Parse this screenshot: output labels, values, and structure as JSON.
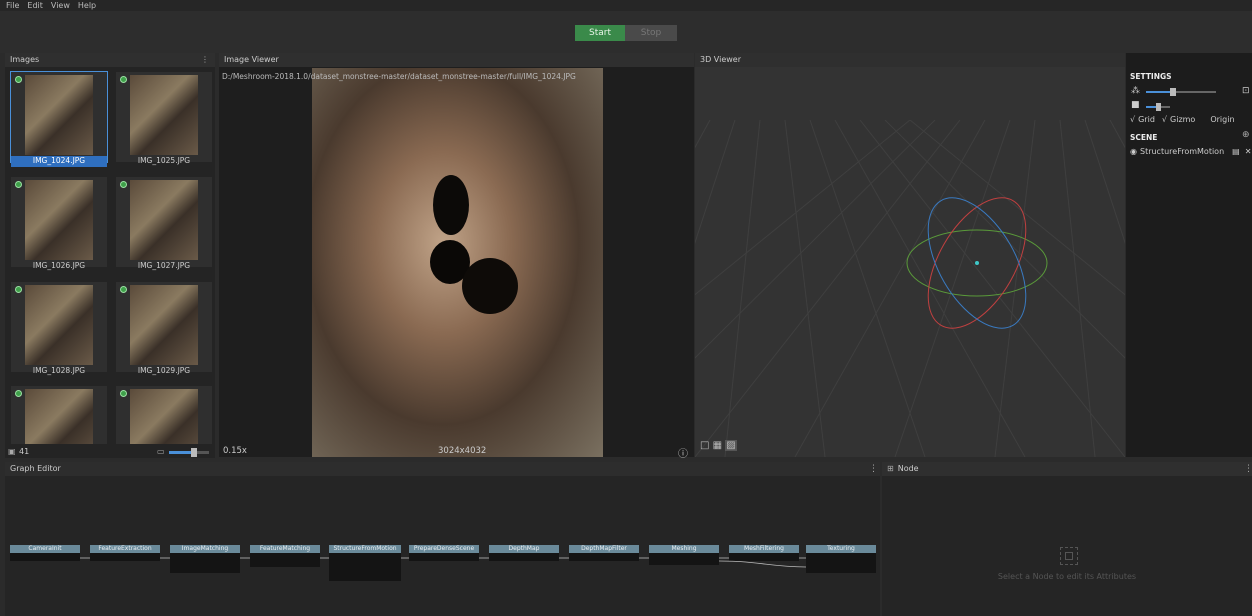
{
  "menu": [
    "File",
    "Edit",
    "View",
    "Help"
  ],
  "toolbar": {
    "start_label": "Start",
    "stop_label": "Stop"
  },
  "images": {
    "title": "Images",
    "count": "41",
    "thumbs": [
      "IMG_1024.JPG",
      "IMG_1025.JPG",
      "IMG_1026.JPG",
      "IMG_1027.JPG",
      "IMG_1028.JPG",
      "IMG_1029.JPG",
      "",
      ""
    ]
  },
  "viewer": {
    "title": "Image Viewer",
    "path": "D:/Meshroom-2018.1.0/dataset_monstree-master/dataset_monstree-master/full/IMG_1024.JPG",
    "zoom": "0.15x",
    "resolution": "3024x4032"
  },
  "viewer3d": {
    "title": "3D Viewer"
  },
  "settings": {
    "title": "SETTINGS",
    "grid_label": "Grid",
    "gizmo_label": "Gizmo",
    "origin_label": "Origin",
    "scene_title": "SCENE",
    "scene_item": "StructureFromMotion"
  },
  "graph": {
    "title": "Graph Editor",
    "nodes": [
      "CameraInit",
      "FeatureExtraction",
      "ImageMatching",
      "FeatureMatching",
      "StructureFromMotion",
      "PrepareDenseScene",
      "DepthMap",
      "DepthMapFilter",
      "Meshing",
      "MeshFiltering",
      "Texturing"
    ]
  },
  "node_panel": {
    "title": "Node",
    "hint": "Select a Node to edit its Attributes"
  },
  "colors": {
    "start": "#3a8a4a",
    "selection": "#2f6fbf",
    "node_header": "#6a8a9a"
  }
}
